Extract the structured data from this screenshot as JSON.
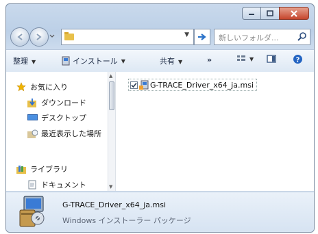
{
  "window": {
    "captions": {
      "minimize": "minimize-icon",
      "maximize": "maximize-icon",
      "close": "close-icon"
    }
  },
  "address": {
    "path": "",
    "search_placeholder": "新しいフォルダ..."
  },
  "toolbar": {
    "organize": "整理",
    "install": "インストール",
    "share": "共有",
    "more": "»"
  },
  "nav": {
    "favorites": "お気に入り",
    "download": "ダウンロード",
    "desktop": "デスクトップ",
    "recent": "最近表示した場所",
    "libraries": "ライブラリ",
    "documents": "ドキュメント"
  },
  "files": [
    {
      "name": "G-TRACE_Driver_x64_ja.msi",
      "checked": true
    }
  ],
  "details": {
    "name": "G-TRACE_Driver_x64_ja.msi",
    "type": "Windows インストーラー パッケージ"
  },
  "colors": {
    "accent": "#3a7bd5",
    "close": "#c5452c",
    "star": "#f0b400"
  }
}
